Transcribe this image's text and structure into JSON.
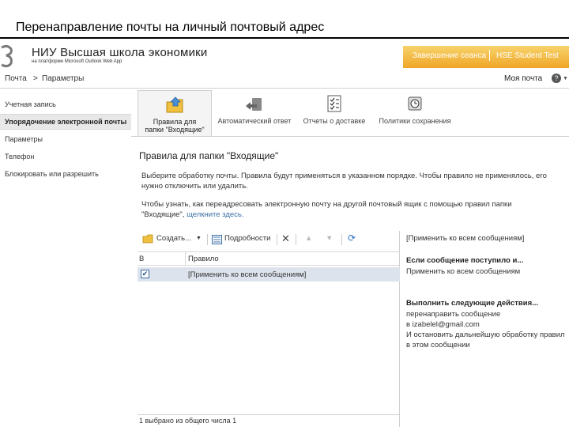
{
  "slide": {
    "title": "Перенаправление почты на личный почтовый адрес"
  },
  "header": {
    "org_name": "НИУ Высшая школа экономики",
    "org_sub": "на платформе Microsoft Outlook Web App",
    "signout": "Завершение сеанса",
    "user": "HSE Student Test"
  },
  "nav": {
    "breadcrumb": [
      "Почта",
      ">",
      "Параметры"
    ],
    "my_mail": "Моя почта",
    "help": "?"
  },
  "sidebar": {
    "items": [
      {
        "label": "Учетная запись"
      },
      {
        "label": "Упорядочение электронной почты"
      },
      {
        "label": "Параметры"
      },
      {
        "label": "Телефон"
      },
      {
        "label": "Блокировать или разрешить"
      }
    ]
  },
  "ribbon": {
    "tabs": [
      {
        "label_1": "Правила для",
        "label_2": "папки \"Входящие\"",
        "icon": "inbox-rules-icon"
      },
      {
        "label_1": "Автоматический ответ",
        "label_2": "",
        "icon": "auto-reply-icon"
      },
      {
        "label_1": "Отчеты о доставке",
        "label_2": "",
        "icon": "delivery-report-icon"
      },
      {
        "label_1": "Политики сохранения",
        "label_2": "",
        "icon": "retention-policy-icon"
      }
    ]
  },
  "content": {
    "title": "Правила для папки \"Входящие\"",
    "desc": "Выберите обработку почты. Правила будут применяться в указанном порядке. Чтобы правило не применялось, его нужно отключить или удалить.",
    "link_text": "Чтобы узнать, как переадресовать электронную почту на другой почтовый ящик с помощью правил папки \"Входящие\", ",
    "link_anchor": "щелкните здесь."
  },
  "toolbar": {
    "new_label": "Создать...",
    "details_label": "Подробности"
  },
  "grid": {
    "col_enabled": "В",
    "col_rule": "Правило",
    "rows": [
      {
        "checked": true,
        "rule": "[Применить ко всем сообщениям]"
      }
    ],
    "footer": "1 выбрано из общего числа 1"
  },
  "detail": {
    "header": "[Применить ко всем сообщениям]",
    "cond_title": "Если сообщение поступило и...",
    "cond_value": "Применить ко всем сообщениям",
    "act_title": "Выполнить следующие действия...",
    "act_1": "перенаправить сообщение",
    "act_2": "в izabelel@gmail.com",
    "act_3": "И остановить дальнейшую обработку правил",
    "act_4": "в этом сообщении"
  }
}
